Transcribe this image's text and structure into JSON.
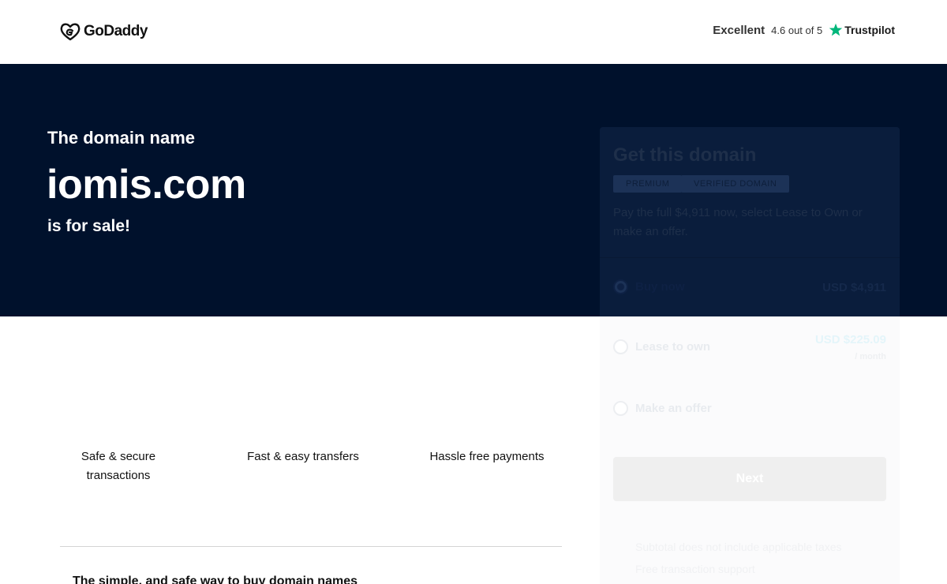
{
  "header": {
    "brand": "GoDaddy",
    "rating_word": "Excellent",
    "rating_score": "4.6 out of 5",
    "review_brand": "Trustpilot"
  },
  "hero": {
    "intro": "The domain name",
    "domain": "iomis.com",
    "sale": "is for sale!"
  },
  "features": [
    {
      "label": "Safe & secure transactions"
    },
    {
      "label": "Fast & easy transfers"
    },
    {
      "label": "Hassle free payments"
    }
  ],
  "bottom": {
    "title": "The simple, and safe way to buy domain names"
  },
  "card": {
    "title": "Get this domain",
    "chips": [
      "PREMIUM",
      "VERIFIED DOMAIN"
    ],
    "description": "Pay the full $4,911 now, select Lease to Own or make an offer.",
    "options": [
      {
        "label": "Buy now",
        "price": "USD $4,911",
        "selected": true
      },
      {
        "label": "Lease to own",
        "price": "USD $225.09",
        "period": "/ month",
        "selected": false
      },
      {
        "label": "Make an offer",
        "selected": false
      }
    ],
    "next_label": "Next",
    "notes": [
      "Subtotal does not include applicable taxes",
      "Free transaction support"
    ]
  },
  "colors": {
    "hero_bg": "#00112c",
    "trustpilot_green": "#00b67a"
  }
}
